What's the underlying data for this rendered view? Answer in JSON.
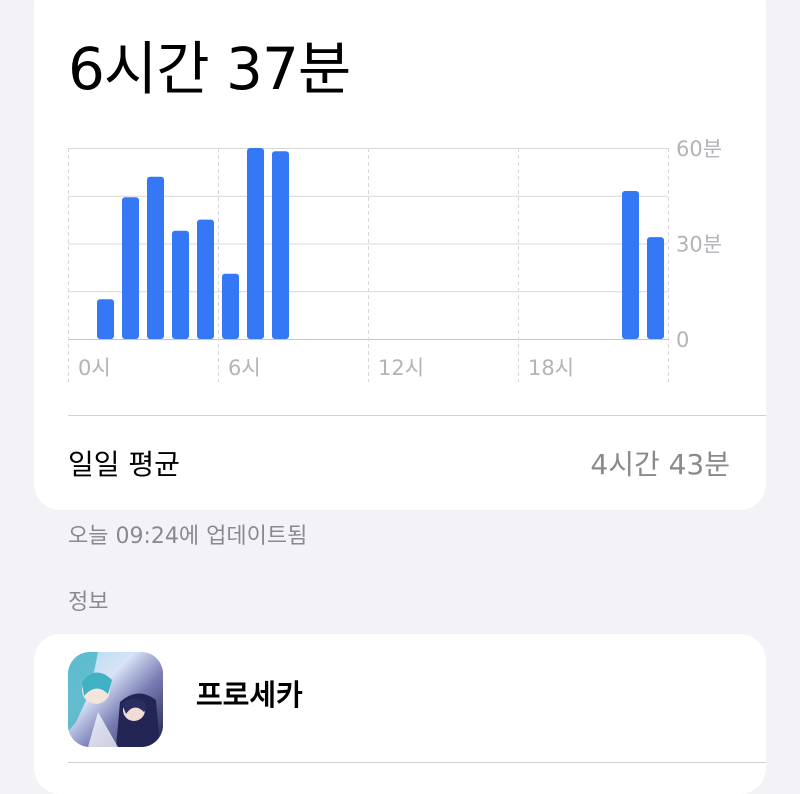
{
  "summary": {
    "total": "6시간 37분",
    "daily_average_label": "일일 평균",
    "daily_average_value": "4시간 43분"
  },
  "updated": "오늘 09:24에 업데이트됨",
  "section_info_title": "정보",
  "app": {
    "name": "프로세카",
    "icon": "app-icon-artwork"
  },
  "colors": {
    "bar": "#3478f6",
    "background": "#f2f2f7",
    "card": "#ffffff",
    "secondary_text": "#8a8a8e",
    "gridline": "#d8d8dc"
  },
  "chart_data": {
    "type": "bar",
    "title": "",
    "xlabel": "",
    "ylabel": "",
    "ylim": [
      0,
      60
    ],
    "y_unit": "분",
    "x_tick_labels": [
      "0시",
      "6시",
      "12시",
      "18시"
    ],
    "y_tick_labels": [
      "60분",
      "30분",
      "0"
    ],
    "categories": [
      "0",
      "1",
      "2",
      "3",
      "4",
      "5",
      "6",
      "7",
      "8",
      "9",
      "10",
      "11",
      "12",
      "13",
      "14",
      "15",
      "16",
      "17",
      "18",
      "19",
      "20",
      "21",
      "22",
      "23"
    ],
    "values": [
      0,
      12.5,
      44.5,
      51,
      34,
      37.5,
      20.5,
      60,
      59,
      0,
      0,
      0,
      0,
      0,
      0,
      0,
      0,
      0,
      0,
      0,
      0,
      0,
      46.5,
      32
    ],
    "grid": true,
    "legend": "none"
  }
}
